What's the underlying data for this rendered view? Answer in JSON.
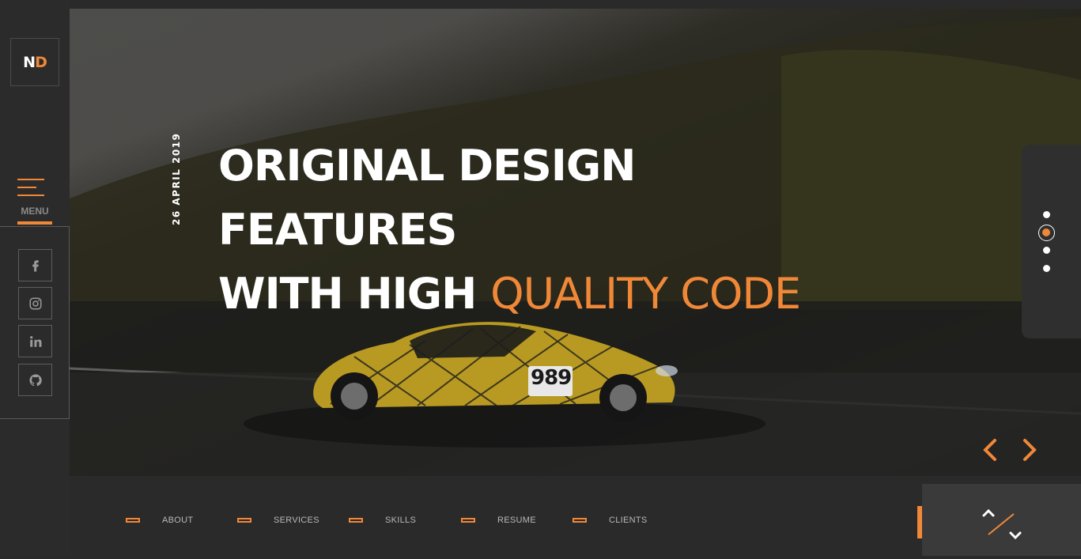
{
  "brand": {
    "logo_letter1": "N",
    "logo_letter2": "D"
  },
  "menu": {
    "label": "MENU"
  },
  "social": [
    {
      "name": "facebook",
      "icon": "facebook-icon"
    },
    {
      "name": "instagram",
      "icon": "instagram-icon"
    },
    {
      "name": "linkedin",
      "icon": "linkedin-icon"
    },
    {
      "name": "github",
      "icon": "github-icon"
    }
  ],
  "hero": {
    "date": "26 APRIL 2019",
    "line1": "ORIGINAL DESIGN",
    "line2": "FEATURES",
    "line3_white": "WITH HIGH ",
    "line3_accent": "QUALITY CODE",
    "car_number": "989"
  },
  "slider": {
    "total": 4,
    "active_index": 1
  },
  "bottom_nav": [
    {
      "label": "ABOUT"
    },
    {
      "label": "SERVICES"
    },
    {
      "label": "SKILLS"
    },
    {
      "label": "RESUME"
    },
    {
      "label": "CLIENTS"
    }
  ],
  "colors": {
    "accent": "#f08838",
    "dark": "#2a2a2a",
    "panel": "#3a3a3a"
  }
}
